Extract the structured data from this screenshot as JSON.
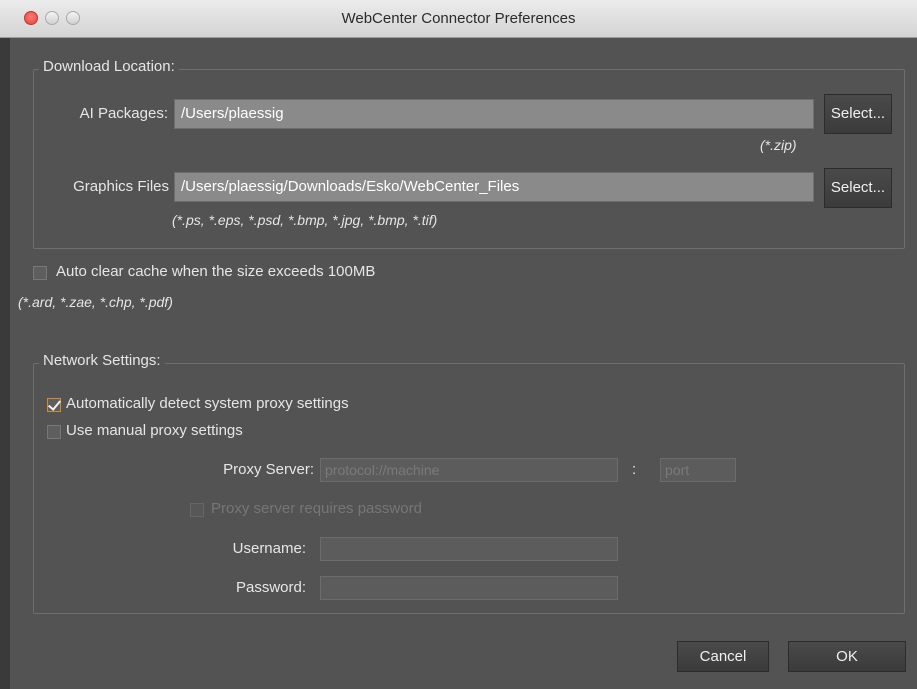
{
  "window": {
    "title": "WebCenter Connector Preferences"
  },
  "download": {
    "legend": "Download Location:",
    "ai_label": "AI Packages:",
    "ai_value": "/Users/plaessig",
    "ai_hint": "(*.zip)",
    "gfx_label": "Graphics Files",
    "gfx_value": "/Users/plaessig/Downloads/Esko/WebCenter_Files",
    "gfx_hint": "(*.ps, *.eps, *.psd, *.bmp, *.jpg, *.bmp, *.tif)",
    "select_label": "Select..."
  },
  "cache": {
    "checkbox_label": "Auto clear cache when the size exceeds 100MB",
    "checked": false,
    "hint": "(*.ard, *.zae, *.chp, *.pdf)"
  },
  "network": {
    "legend": "Network Settings:",
    "auto_detect_label": "Automatically detect system proxy settings",
    "auto_detect_checked": true,
    "manual_label": "Use manual proxy settings",
    "manual_checked": false,
    "proxy_server_label": "Proxy Server:",
    "proxy_placeholder": "protocol://machine",
    "colon": ":",
    "port_placeholder": "port",
    "requires_password_label": "Proxy server requires password",
    "username_label": "Username:",
    "password_label": "Password:"
  },
  "footer": {
    "cancel_label": "Cancel",
    "ok_label": "OK"
  },
  "colors": {
    "background": "#535353",
    "checkbox_accent": "#d28a2a"
  }
}
